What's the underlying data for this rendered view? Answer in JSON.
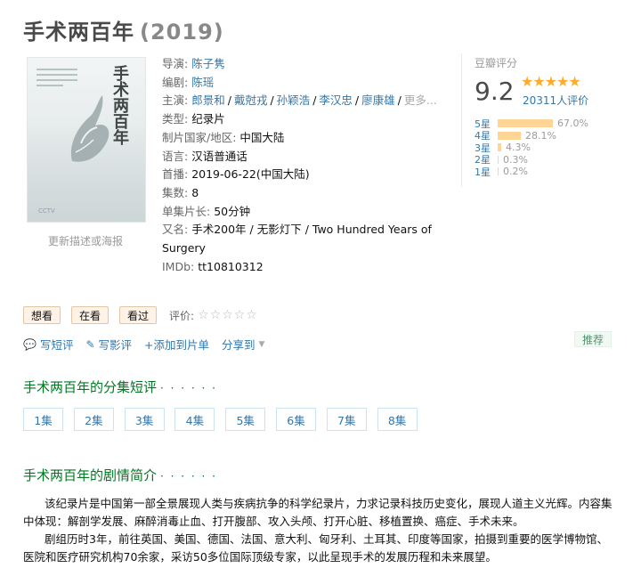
{
  "header": {
    "title": "手术两百年",
    "year": "(2019)"
  },
  "poster": {
    "title_text": "手术两百年",
    "update_link": "更新描述或海报"
  },
  "info": {
    "director_label": "导演:",
    "director": "陈子隽",
    "writer_label": "编剧:",
    "writer": "陈瑶",
    "cast_label": "主演:",
    "cast": [
      "郎景和",
      "戴尅戎",
      "孙颖浩",
      "李汉忠",
      "廖康雄"
    ],
    "cast_more": "更多...",
    "genre_label": "类型:",
    "genre": "纪录片",
    "country_label": "制片国家/地区:",
    "country": "中国大陆",
    "language_label": "语言:",
    "language": "汉语普通话",
    "release_label": "首播:",
    "release": "2019-06-22(中国大陆)",
    "episodes_label": "集数:",
    "episodes": "8",
    "runtime_label": "单集片长:",
    "runtime": "50分钟",
    "aka_label": "又名:",
    "aka": "手术200年 / 无影灯下 / Two Hundred Years of Surgery",
    "imdb_label": "IMDb:",
    "imdb": "tt10810312"
  },
  "rating": {
    "label": "豆瓣评分",
    "score": "9.2",
    "stars": "★★★★★",
    "votes": "20311人评价",
    "distribution": [
      {
        "label": "5星",
        "percent": 67.0,
        "text": "67.0%"
      },
      {
        "label": "4星",
        "percent": 28.1,
        "text": "28.1%"
      },
      {
        "label": "3星",
        "percent": 4.3,
        "text": "4.3%"
      },
      {
        "label": "2星",
        "percent": 0.3,
        "text": "0.3%"
      },
      {
        "label": "1星",
        "percent": 0.2,
        "text": "0.2%"
      }
    ]
  },
  "actions": {
    "want": "想看",
    "watching": "在看",
    "watched": "看过",
    "rate_label": "评价:",
    "rate_stars": "☆☆☆☆☆"
  },
  "ops": {
    "short_review": "写短评",
    "review": "写影评",
    "add_list": "+添加到片单",
    "share": "分享到"
  },
  "recommend": "推荐",
  "episodes_section": {
    "title": "手术两百年的分集短评",
    "dots": "· · · · · ·",
    "items": [
      "1集",
      "2集",
      "3集",
      "4集",
      "5集",
      "6集",
      "7集",
      "8集"
    ]
  },
  "summary_section": {
    "title": "手术两百年的剧情简介",
    "dots": "· · · · · ·",
    "p1": "该纪录片是中国第一部全景展现人类与疾病抗争的科学纪录片，力求记录科技历史变化，展现人道主义光辉。内容集中体现：解剖学发展、麻醉消毒止血、打开腹部、攻入头颅、打开心脏、移植置换、癌症、手术未来。",
    "p2": "剧组历时3年，前往英国、美国、德国、法国、意大利、匈牙利、土耳其、印度等国家，拍摄到重要的医学博物馆、医院和医疗研究机构70余家，采访50多位国际顶级专家，以此呈现手术的发展历程和未来展望。"
  },
  "colors": {
    "link": "#3377aa",
    "green": "#007722",
    "star": "#ffac2d",
    "bar": "#ffd596"
  }
}
